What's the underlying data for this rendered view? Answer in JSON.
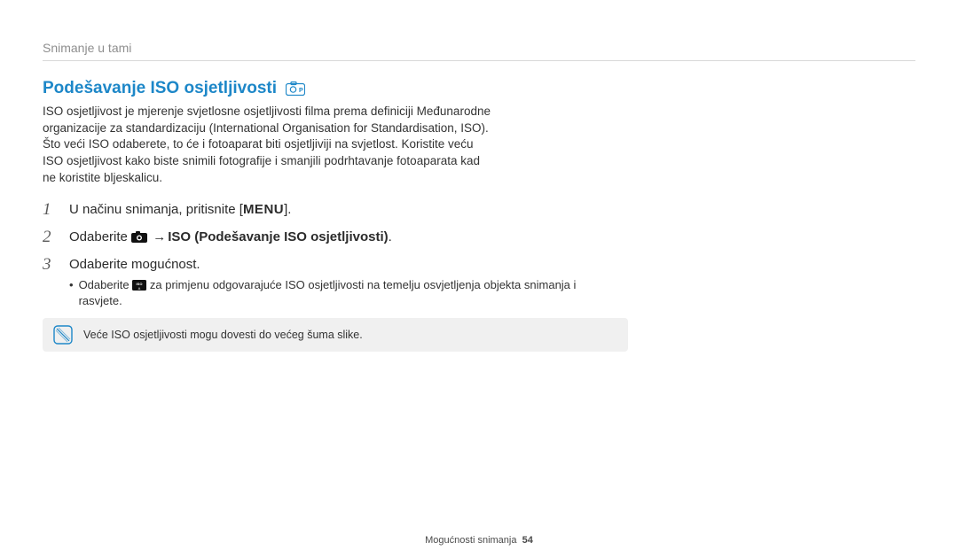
{
  "breadcrumb": "Snimanje u tami",
  "heading": "Podešavanje ISO osjetljivosti",
  "intro": "ISO osjetljivost je mjerenje svjetlosne osjetljivosti filma prema definiciji Međunarodne organizacije za standardizaciju (International Organisation for Standardisation, ISO). Što veći ISO odaberete, to će i fotoaparat biti osjetljiviji na svjetlost. Koristite veću ISO osjetljivost kako biste snimili fotografije i smanjili podrhtavanje fotoaparata kad ne koristite bljeskalicu.",
  "steps": {
    "s1_num": "1",
    "s1_pre": "U načinu snimanja, pritisnite [",
    "s1_menu": "MENU",
    "s1_post": "].",
    "s2_num": "2",
    "s2_pre": "Odaberite ",
    "s2_arrow": " → ",
    "s2_bold": "ISO (Podešavanje ISO osjetljivosti)",
    "s2_post": ".",
    "s3_num": "3",
    "s3_text": "Odaberite mogućnost.",
    "s3_sub_pre": "Odaberite ",
    "s3_sub_post": " za primjenu odgovarajuće ISO osjetljivosti na temelju osvjetljenja objekta snimanja i rasvjete."
  },
  "note": "Veće ISO osjetljivosti mogu dovesti do većeg šuma slike.",
  "footer_label": "Mogućnosti snimanja",
  "footer_page": "54"
}
